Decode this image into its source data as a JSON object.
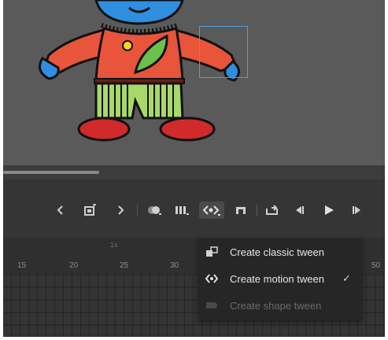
{
  "timeline": {
    "ruler_labels": [
      "15",
      "20",
      "25",
      "30",
      "50"
    ],
    "marker": "1s"
  },
  "tween_menu": {
    "items": [
      {
        "label": "Create classic tween",
        "checked": false,
        "enabled": true
      },
      {
        "label": "Create motion tween",
        "checked": true,
        "enabled": true
      },
      {
        "label": "Create shape tween",
        "checked": false,
        "enabled": false
      }
    ],
    "check_glyph": "✓"
  },
  "toolbar": {
    "icons": [
      "chevron-left-icon",
      "insert-keyframe-icon",
      "chevron-right-icon",
      "onion-skin-icon",
      "frame-view-icon",
      "tween-icon",
      "loop-icon",
      "return-to-first-frame-icon",
      "step-back-icon",
      "play-icon",
      "step-forward-icon"
    ]
  },
  "colors": {
    "stage": "#5a5a5a",
    "panel": "#353535",
    "timeline": "#2e2e2e",
    "menu": "#262626",
    "selection": "#4aa0e6"
  }
}
